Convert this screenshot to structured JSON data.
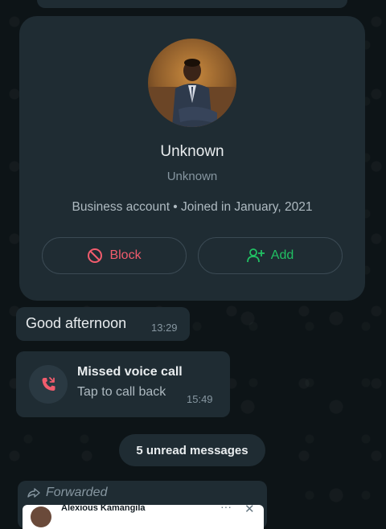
{
  "profile": {
    "name": "Unknown",
    "subname": "Unknown",
    "meta": "Business account • Joined in January, 2021",
    "block_label": "Block",
    "add_label": "Add"
  },
  "messages": [
    {
      "text": "Good afternoon",
      "time": "13:29"
    }
  ],
  "call": {
    "title": "Missed voice call",
    "subtitle": "Tap to call back",
    "time": "15:49"
  },
  "unread": "5 unread messages",
  "forwarded": {
    "label": "Forwarded",
    "preview_name": "Alexious Kamangila"
  },
  "colors": {
    "background": "#0d1417",
    "bubble": "#1f2c33",
    "block_red": "#f15c6d",
    "add_green": "#21c063"
  },
  "icons": {
    "block": "block-icon",
    "add": "add-contact-icon",
    "missed_call": "missed-call-icon",
    "forward": "forward-icon"
  }
}
